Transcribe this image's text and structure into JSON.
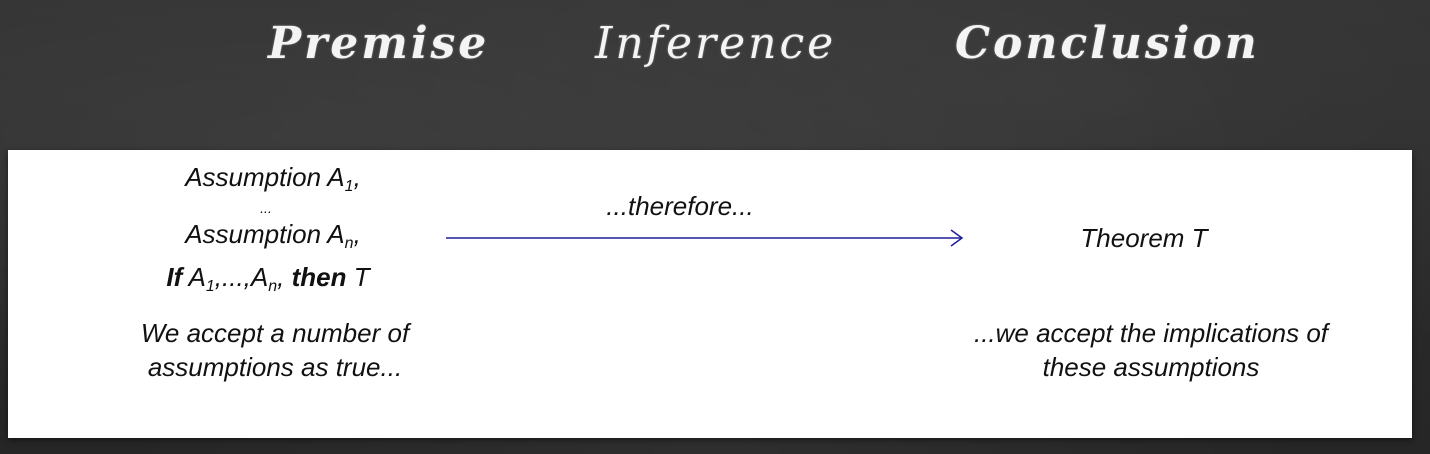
{
  "headers": {
    "premise": "Premise",
    "inference": "Inference",
    "conclusion": "Conclusion"
  },
  "premise": {
    "assumption_first_label": "Assumption A",
    "assumption_first_sub": "1",
    "assumption_first_suffix": ",",
    "ellipsis": "...",
    "assumption_last_label": "Assumption A",
    "assumption_last_sub": "n",
    "assumption_last_suffix": ",",
    "implication_if": "If",
    "implication_a1": " A",
    "implication_a1_sub": "1",
    "implication_middle": ",...,A",
    "implication_an_sub": "n",
    "implication_comma": ",",
    "implication_then": "then",
    "implication_t": " T",
    "caption_line1": "We accept a number of",
    "caption_line2": "assumptions as true..."
  },
  "inference": {
    "label": "...therefore..."
  },
  "conclusion": {
    "theorem": "Theorem T",
    "caption_line1": "...we accept the implications of",
    "caption_line2": "these assumptions"
  },
  "colors": {
    "arrow": "#1f1f9e",
    "board": "#2b2b2b"
  }
}
